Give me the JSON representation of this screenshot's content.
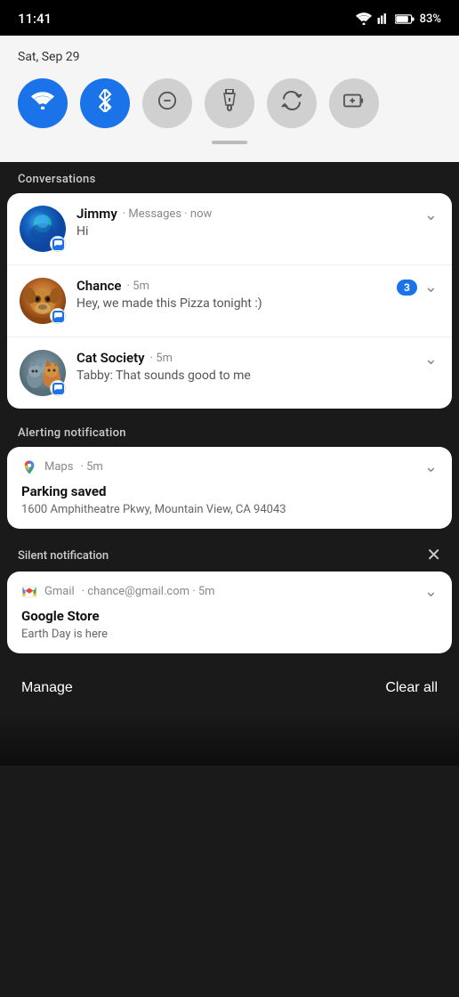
{
  "statusBar": {
    "time": "11:41",
    "battery": "83%"
  },
  "quickSettings": {
    "date": "Sat, Sep 29",
    "toggles": [
      {
        "id": "wifi",
        "active": true,
        "icon": "wifi",
        "label": "Wi-Fi"
      },
      {
        "id": "bluetooth",
        "active": true,
        "icon": "bluetooth",
        "label": "Bluetooth"
      },
      {
        "id": "dnd",
        "active": false,
        "icon": "dnd",
        "label": "Do Not Disturb"
      },
      {
        "id": "flashlight",
        "active": false,
        "icon": "flashlight",
        "label": "Flashlight"
      },
      {
        "id": "rotate",
        "active": false,
        "icon": "rotate",
        "label": "Auto-rotate"
      },
      {
        "id": "battery-saver",
        "active": false,
        "icon": "battery-plus",
        "label": "Battery Saver"
      }
    ]
  },
  "sections": {
    "conversations": {
      "label": "Conversations",
      "items": [
        {
          "name": "Jimmy",
          "app": "Messages",
          "time": "now",
          "body": "Hi",
          "unreadCount": null,
          "avatarType": "jimmy"
        },
        {
          "name": "Chance",
          "app": "Messages",
          "time": "5m",
          "body": "Hey, we made this Pizza tonight :)",
          "unreadCount": "3",
          "avatarType": "chance"
        },
        {
          "name": "Cat Society",
          "app": "Messages",
          "time": "5m",
          "body": "Tabby: That sounds good to me",
          "unreadCount": null,
          "avatarType": "cat"
        }
      ]
    },
    "alerting": {
      "label": "Alerting notification",
      "items": [
        {
          "app": "Maps",
          "time": "5m",
          "title": "Parking saved",
          "body": "1600 Amphitheatre Pkwy, Mountain View, CA 94043"
        }
      ]
    },
    "silent": {
      "label": "Silent notification",
      "items": [
        {
          "app": "Gmail",
          "email": "chance@gmail.com",
          "time": "5m",
          "title": "Google Store",
          "body": "Earth Day is here"
        }
      ]
    }
  },
  "footer": {
    "manage": "Manage",
    "clearAll": "Clear all"
  }
}
